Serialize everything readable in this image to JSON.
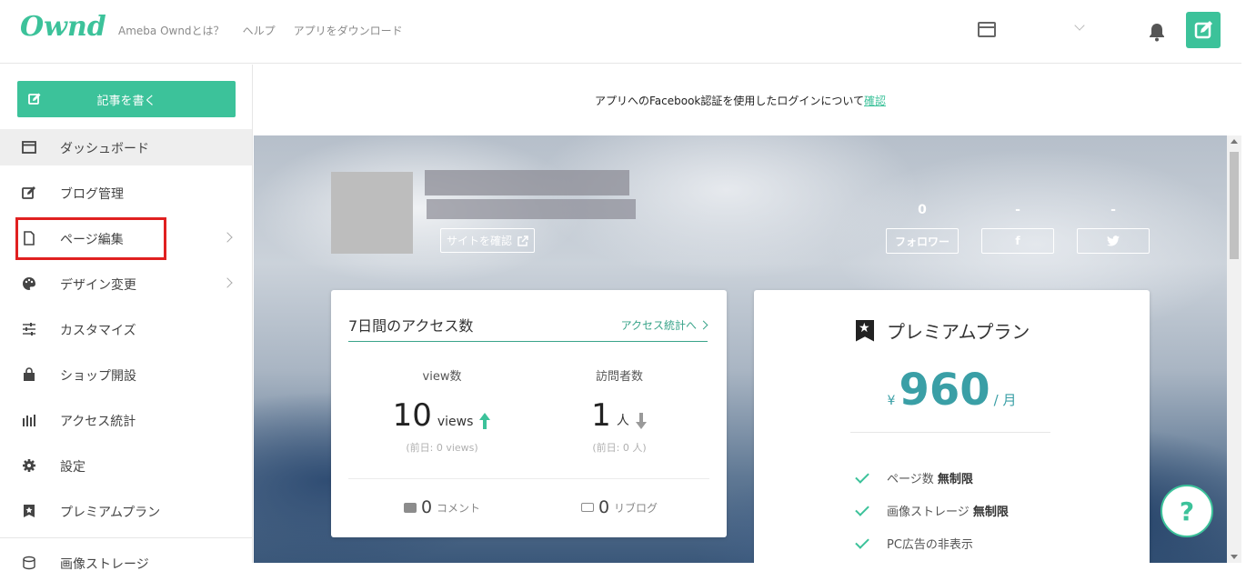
{
  "header": {
    "logo": "Ownd",
    "nav": [
      "Ameba Owndとは？",
      "ヘルプ",
      "アプリをダウンロード"
    ],
    "icons": [
      "site-window-icon",
      "chevron-down-icon",
      "bell-icon",
      "edit-icon"
    ],
    "accent_color": "#3cc29a"
  },
  "sidebar": {
    "write_button": "記事を書く",
    "items": [
      {
        "label": "ダッシュボード",
        "icon": "dashboard-icon"
      },
      {
        "label": "ブログ管理",
        "icon": "edit-icon"
      },
      {
        "label": "ページ編集",
        "icon": "page-icon"
      },
      {
        "label": "デザイン変更",
        "icon": "palette-icon"
      },
      {
        "label": "カスタマイズ",
        "icon": "sliders-icon"
      },
      {
        "label": "ショップ開設",
        "icon": "shop-icon"
      },
      {
        "label": "アクセス統計",
        "icon": "bar-chart-icon"
      },
      {
        "label": "設定",
        "icon": "gear-icon"
      },
      {
        "label": "プレミアムプラン",
        "icon": "premium-bookmark-icon"
      },
      {
        "label": "画像ストレージ",
        "icon": "storage-icon"
      }
    ],
    "highlight_color": "#e02020"
  },
  "notice": {
    "text": "アプリへのFacebook認証を使用したログインについて",
    "link": "確認"
  },
  "hero": {
    "site_button": "サイトを確認",
    "followers": {
      "count": "0",
      "label": "フォロワー"
    },
    "facebook": {
      "count": "-",
      "label": "f"
    },
    "twitter": {
      "count": "-",
      "label": "twitter-icon"
    }
  },
  "access": {
    "title": "7日間のアクセス数",
    "link": "アクセス統計へ",
    "views": {
      "label": "view数",
      "value": "10",
      "unit": "views",
      "prev": "(前日: 0 views)"
    },
    "visitors": {
      "label": "訪問者数",
      "value": "1",
      "unit": "人",
      "prev": "(前日: 0 人)"
    },
    "comments": {
      "value": "0",
      "label": "コメント"
    },
    "reblogs": {
      "value": "0",
      "label": "リブログ"
    }
  },
  "premium": {
    "title": "プレミアムプラン",
    "currency": "¥",
    "price": "960",
    "per": "/ 月",
    "features": [
      {
        "text": "ページ数 ",
        "bold": "無制限"
      },
      {
        "text": "画像ストレージ ",
        "bold": "無制限"
      },
      {
        "text": "PC広告の非表示",
        "bold": ""
      }
    ]
  },
  "help": "?"
}
